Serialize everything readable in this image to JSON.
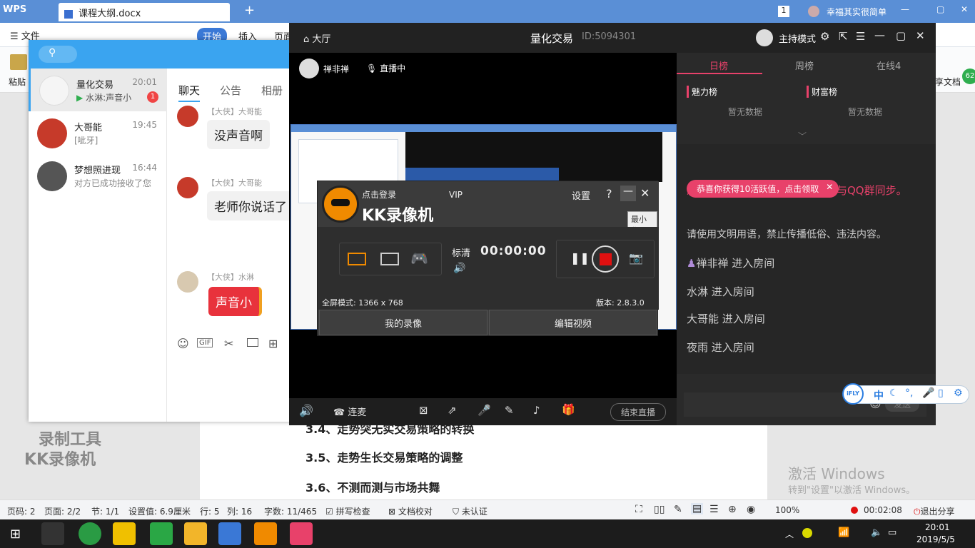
{
  "wps": {
    "app_label": "WPS",
    "doc_tab": "课程大纲.docx",
    "user": "幸福其实很简单",
    "menu_file": "文件",
    "menu_start": "开始",
    "menu_insert": "插入",
    "menu_page": "页面",
    "toolbar_paste": "粘贴",
    "toolbar_share": "享文档",
    "badge": "62"
  },
  "doc": {
    "line_34": "3.4、走势突无实交易策略的转换",
    "line_35": "3.5、走势生长交易策略的调整",
    "line_36": "3.6、不测而测与市场共舞"
  },
  "watermark": {
    "line1": "录制工具",
    "line2": "KK录像机",
    "activate1": "激活 Windows",
    "activate2": "转到\"设置\"以激活 Windows。"
  },
  "status": {
    "page_no": "页码: 2",
    "page": "页面: 2/2",
    "section": "节: 1/1",
    "setting": "设置值: 6.9厘米",
    "row": "行: 5",
    "col": "列: 16",
    "words": "字数: 11/465",
    "spell": "拼写检查",
    "proof": "文档校对",
    "cert": "未认证",
    "zoom": "100%",
    "rec_time": "00:02:08",
    "exit_share": "退出分享"
  },
  "taskbar": {
    "time": "20:01",
    "date": "2019/5/5"
  },
  "qq": {
    "convs": [
      {
        "name": "量化交易",
        "time": "20:01",
        "sub": "水淋:声音小",
        "unread": "1"
      },
      {
        "name": "大哥能",
        "time": "19:45",
        "sub": "[呲牙]"
      },
      {
        "name": "梦想照进现",
        "time": "16:44",
        "sub": "对方已成功接收了您"
      }
    ],
    "tabs": [
      "聊天",
      "公告",
      "相册"
    ],
    "messages": [
      {
        "name": "【大侠】大哥能",
        "text": "没声音啊"
      },
      {
        "name": "【大侠】大哥能",
        "text": "老师你说话了"
      },
      {
        "name": "【大侠】水淋",
        "text": "声音小"
      }
    ]
  },
  "live": {
    "lobby": "大厅",
    "title": "量化交易",
    "id": "ID:5094301",
    "host_mode": "主持模式",
    "streamer": "禅非禅",
    "live_status": "直播中",
    "rank_tabs": [
      "日榜",
      "周榜",
      "在线4"
    ],
    "charm": "魅力榜",
    "wealth": "财富榜",
    "no_data": "暂无数据",
    "toast": "恭喜你获得10活跃值，点击领取",
    "notice": "想安全，视频房间文字聊天不再与QQ群同步。",
    "rule": "请使用文明用语，禁止传播低俗、违法内容。",
    "enters": [
      "禅非禅 进入房间",
      "水淋 进入房间",
      "大哥能  进入房间",
      "夜雨 进入房间"
    ],
    "connect": "连麦",
    "end_live": "结束直播",
    "send": "发送"
  },
  "kk": {
    "login": "点击登录",
    "vip": "VIP",
    "settings": "设置",
    "help": "?",
    "name": "KK录像机",
    "tooltip": "最小化",
    "quality": "标清",
    "timer": "00:00:00",
    "mode": "全屏模式: 1366 x 768",
    "version": "版本: 2.8.3.0",
    "my_videos": "我的录像",
    "edit_video": "编辑视频"
  },
  "ime": {
    "brand": "iFLY",
    "lang": "中"
  },
  "colors": {
    "wps_blue": "#5a8fd6",
    "qq_blue": "#3aa4f0",
    "live_pink": "#e8416a",
    "record_red": "#e01010",
    "kk_orange": "#f08a00"
  }
}
